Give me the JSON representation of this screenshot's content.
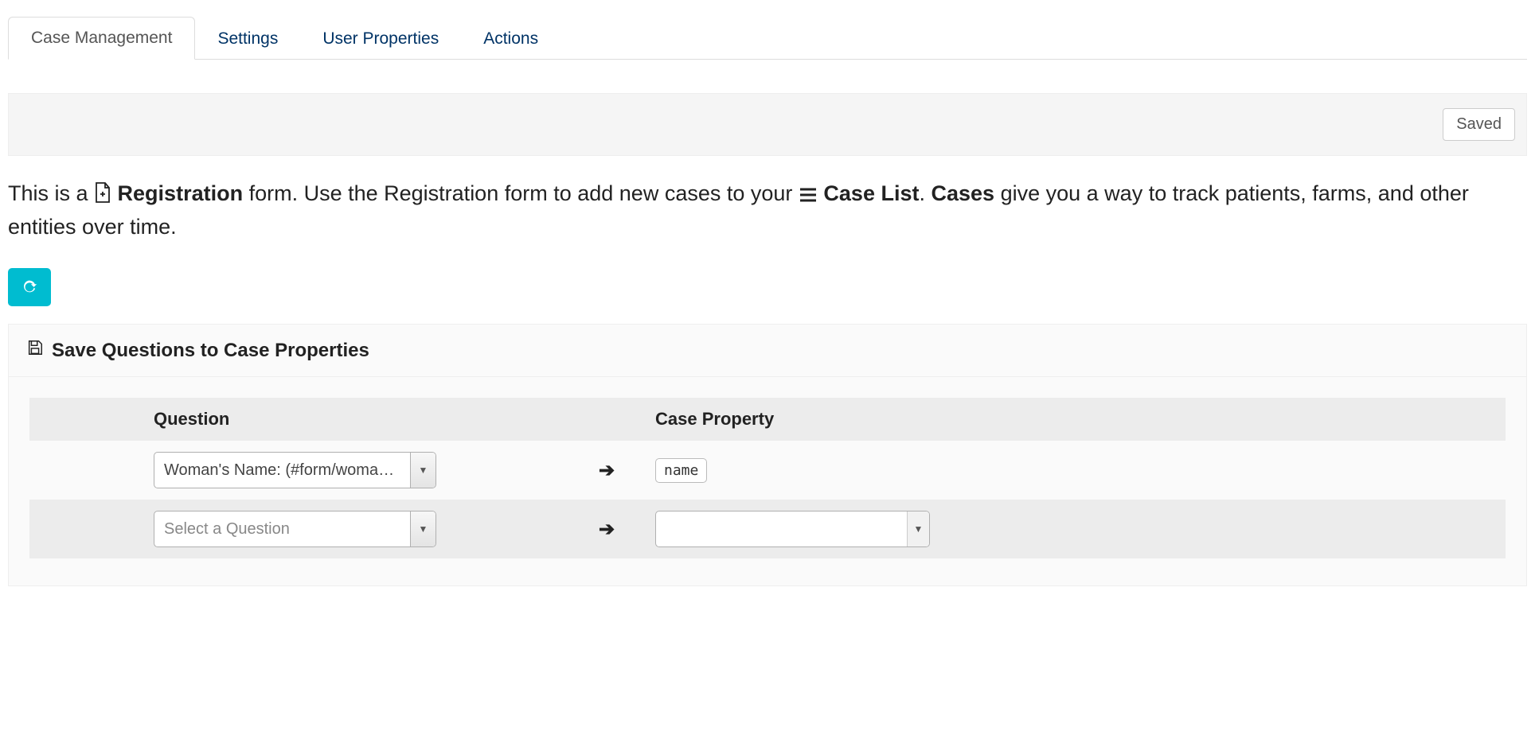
{
  "tabs": [
    {
      "label": "Case Management",
      "active": true
    },
    {
      "label": "Settings",
      "active": false
    },
    {
      "label": "User Properties",
      "active": false
    },
    {
      "label": "Actions",
      "active": false
    }
  ],
  "saved_bar": {
    "label": "Saved"
  },
  "description": {
    "text_1": "This is a ",
    "bold_registration": "Registration",
    "text_2": " form. Use the Registration form to add new cases to your ",
    "bold_case_list": "Case List",
    "text_3_after_case_list": ". ",
    "bold_cases": "Cases",
    "text_4": " give you a way to track patients, farms, and other entities over time."
  },
  "panel": {
    "title": "Save Questions to Case Properties",
    "columns": {
      "question": "Question",
      "case_property": "Case Property"
    },
    "rows": [
      {
        "question": "Woman's Name: (#form/woma…",
        "question_placeholder": false,
        "case_property_tag": "name",
        "case_property_select": null
      },
      {
        "question": "Select a Question",
        "question_placeholder": true,
        "case_property_tag": null,
        "case_property_select": ""
      }
    ]
  }
}
